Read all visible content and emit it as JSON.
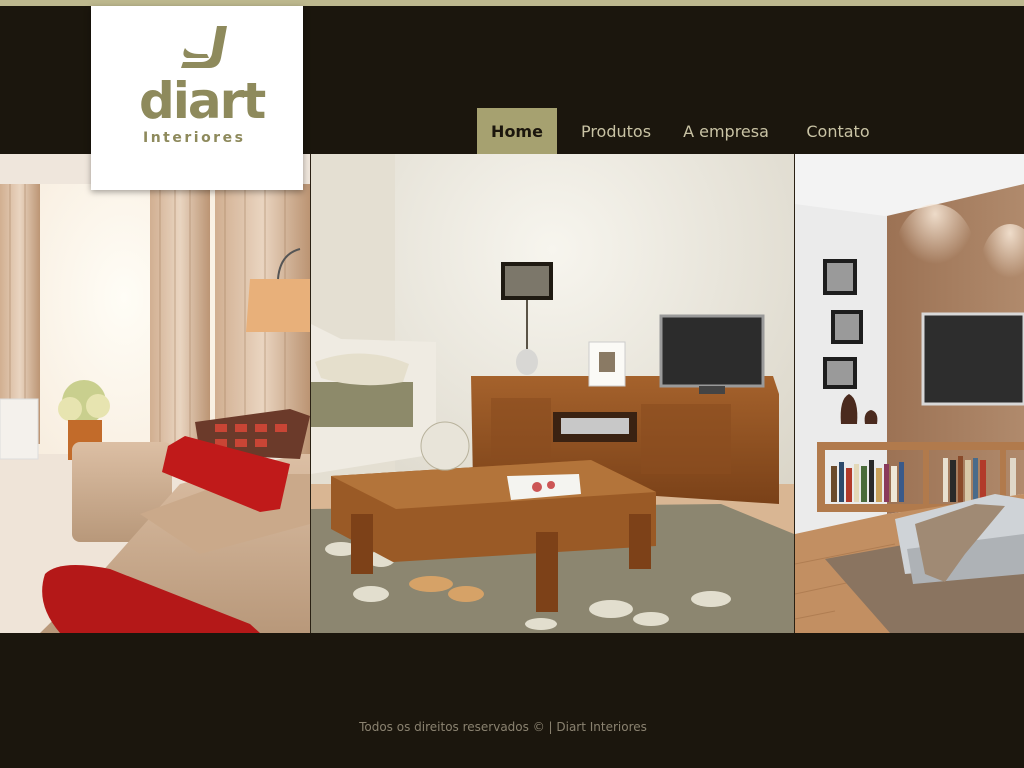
{
  "brand": {
    "logo_word": "diart",
    "logo_sub": "Interiores"
  },
  "nav": {
    "items": [
      {
        "label": "Home",
        "active": true
      },
      {
        "label": "Produtos",
        "active": false
      },
      {
        "label": "A empresa",
        "active": false
      },
      {
        "label": "Contato",
        "active": false
      }
    ]
  },
  "footer": {
    "text": "Todos os direitos reservados © | Diart Interiores"
  },
  "colors": {
    "background": "#1b160d",
    "accent": "#a6a170",
    "nav_text": "#c9c3a4",
    "logo": "#8e8a5c"
  }
}
